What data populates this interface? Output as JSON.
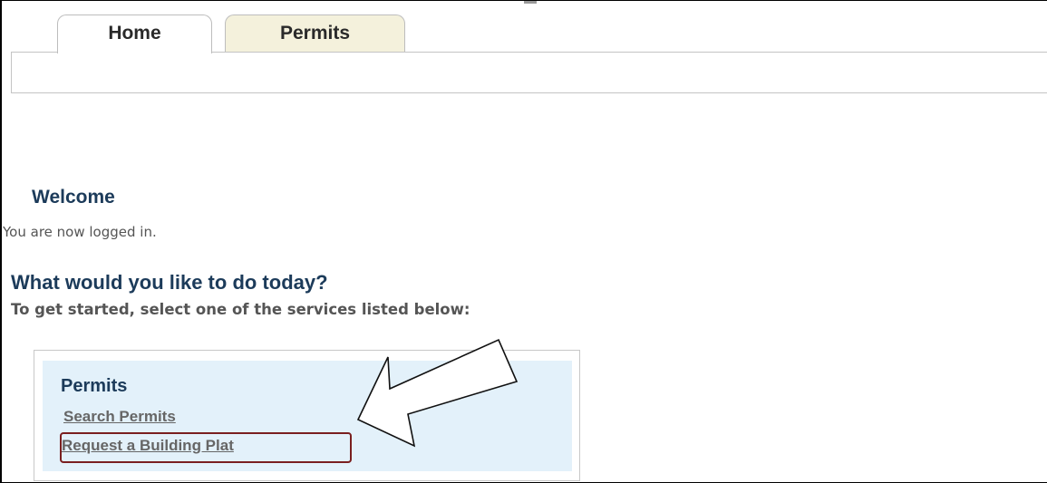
{
  "tabs": [
    {
      "label": "Home",
      "active": true
    },
    {
      "label": "Permits",
      "active": false
    }
  ],
  "welcome": {
    "heading": "Welcome",
    "status": "You are now logged in."
  },
  "prompt": {
    "question": "What would you like to do today?",
    "instructions": "To get started, select one of the services listed below:"
  },
  "services": {
    "title": "Permits",
    "links": [
      {
        "label": "Search Permits"
      },
      {
        "label": "Request a Building Plat",
        "highlighted": true
      }
    ]
  },
  "colors": {
    "heading": "#1c3b5a",
    "active_tab_bg": "#ffffff",
    "inactive_tab_bg": "#f4f1dc",
    "service_panel_bg": "#e3f1fa",
    "highlight_border": "#7a1f1f"
  },
  "annotations": {
    "arrow": "pointing-arrow-icon"
  }
}
